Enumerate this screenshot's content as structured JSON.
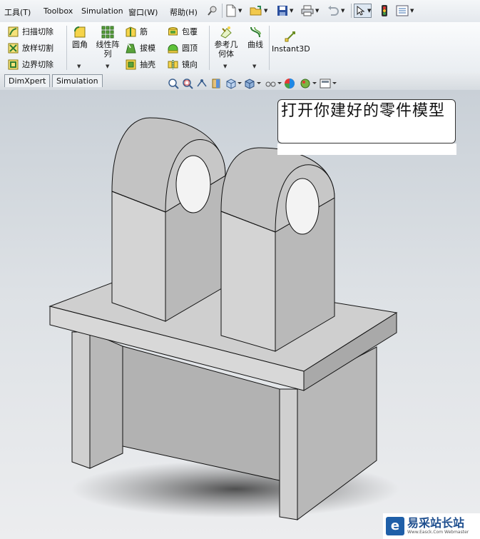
{
  "menu": {
    "items": [
      "工具(T)",
      "Toolbox",
      "Simulation",
      "窗口(W)",
      "帮助(H)"
    ]
  },
  "toolbar_icons": [
    "pin-icon",
    "new-document-icon",
    "open-folder-icon",
    "save-icon",
    "print-icon",
    "undo-icon",
    "select-arrow-icon",
    "rebuild-icon",
    "options-icon"
  ],
  "command_manager": {
    "cut_group": [
      "扫描切除",
      "放样切割",
      "边界切除"
    ],
    "fillet": "圆角",
    "linear_pattern": "线性阵列",
    "rib_group": [
      "筋",
      "拔模",
      "抽壳"
    ],
    "wrap_group": [
      "包覆",
      "圆顶",
      "镜向"
    ],
    "reference_geometry": "参考几何体",
    "curves": "曲线",
    "instant3d": "Instant3D"
  },
  "tabs": [
    "DimXpert",
    "Simulation"
  ],
  "view_toolbar_icons": [
    "zoom-to-fit-icon",
    "zoom-area-icon",
    "previous-view-icon",
    "section-view-icon",
    "view-orientation-icon",
    "display-style-icon",
    "hide-show-icon",
    "edit-appearance-icon",
    "apply-scene-icon",
    "view-settings-icon"
  ],
  "callout": {
    "text": "打开你建好的零件模型"
  },
  "watermark": {
    "logo": "e",
    "title": "易采站长站",
    "subtitle": "Www.Easck.Com Webmaster"
  },
  "colors": {
    "model_face_light": "#d2d2d2",
    "model_face_mid": "#bcbcbc",
    "model_face_dark": "#a2a2a2",
    "watermark_blue": "#1f5fa8"
  }
}
